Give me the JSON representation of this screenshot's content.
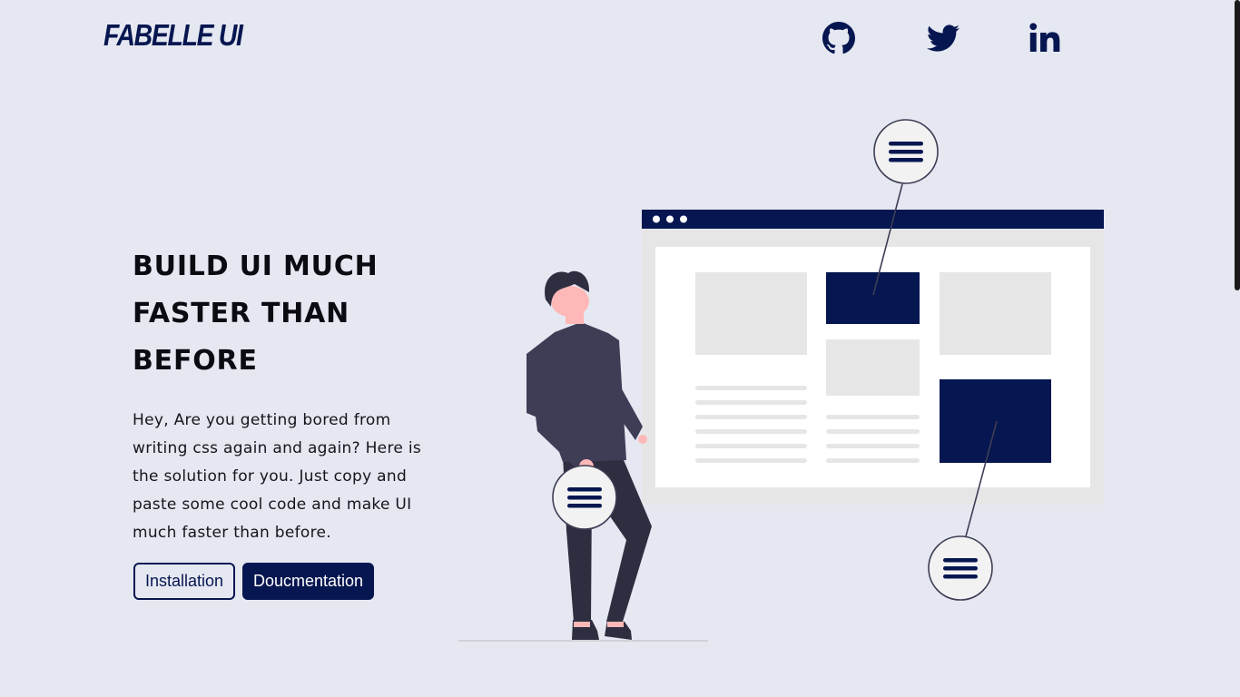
{
  "brand": {
    "logo_text": "FABELLE UI"
  },
  "social": {
    "github": "github-icon",
    "twitter": "twitter-icon",
    "linkedin": "linkedin-icon"
  },
  "hero": {
    "headline_lines": [
      "BUILD UI MUCH",
      "FASTER THAN",
      "BEFORE"
    ],
    "description": "Hey, Are you getting bored from writing css again and again? Here is the solution for you. Just copy and paste some cool code and make UI much faster than before.",
    "buttons": {
      "installation": "Installation",
      "documentation": "Doucmentation"
    }
  },
  "colors": {
    "accent": "#061650",
    "background": "#e5e8f1",
    "figure_body": "#3f3d56",
    "skin": "#ffb8b8"
  }
}
